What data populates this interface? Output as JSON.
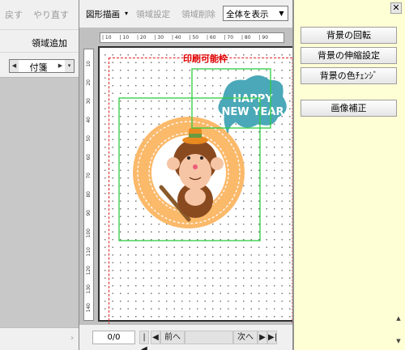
{
  "left_panel": {
    "undo_label": "戻す",
    "redo_label": "やり直す",
    "add_region_label": "領域追加",
    "category_value": "付箋"
  },
  "toolbar": {
    "draw_shape_label": "図形描画",
    "region_settings_label": "領域設定",
    "region_delete_label": "領域削除",
    "view_select_value": "全体を表示"
  },
  "canvas": {
    "print_area_label": "印刷可能枠",
    "ruler_h_ticks": [
      "10",
      "10",
      "20",
      "30",
      "40",
      "50",
      "60",
      "70",
      "80",
      "90"
    ],
    "ruler_v_ticks": [
      "10",
      "20",
      "30",
      "40",
      "50",
      "60",
      "70",
      "80",
      "90",
      "100",
      "110",
      "120",
      "130",
      "140"
    ],
    "greeting_line1": "HAPPY",
    "greeting_line2": "NEW YEAR"
  },
  "bottom_bar": {
    "page_value": "0/0",
    "prev_label": "前へ",
    "next_label": "次へ"
  },
  "right_panel": {
    "bg_rotate_label": "背景の回転",
    "bg_scale_label": "背景の伸縮設定",
    "bg_color_label": "背景の色ﾁｪﾝｼﾞ",
    "image_correct_label": "画像補正"
  },
  "colors": {
    "print_area": "#e02020",
    "selection": "#2ecc40",
    "right_panel_bg": "#ffffd6",
    "wreath": "#fbb96a",
    "bubble": "#4aa8b8"
  }
}
